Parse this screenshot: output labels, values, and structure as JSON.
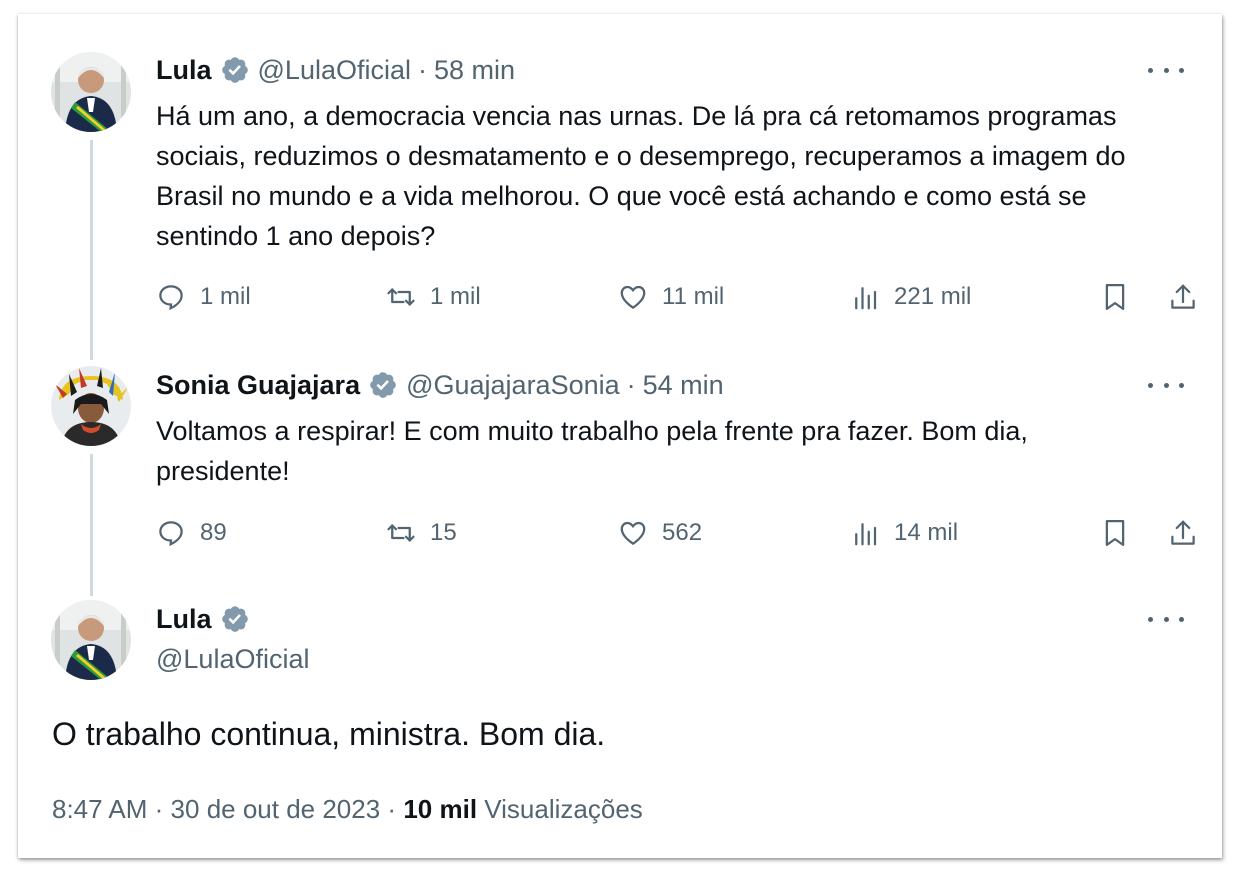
{
  "colors": {
    "verified_badge": "#829aab",
    "secondary_text": "#536471",
    "primary_text": "#0f1419",
    "thread_line": "#cfd9de"
  },
  "icons": {
    "reply": "speech-bubble-icon",
    "retweet": "retweet-arrows-icon",
    "like": "heart-icon",
    "views": "bar-chart-icon",
    "bookmark": "bookmark-icon",
    "share": "share-upload-icon",
    "more": "more-dots-icon",
    "verified": "verified-badge-icon"
  },
  "tweets": [
    {
      "name": "Lula",
      "handle": "@LulaOficial",
      "separator": "·",
      "time": "58 min",
      "text": "Há um ano, a democracia vencia nas urnas. De lá pra cá retomamos programas sociais, reduzimos o desmatamento e o desemprego, recuperamos a imagem do Brasil no mundo e a vida melhorou. O que você está achando e como está se sentindo 1 ano depois?",
      "replies": "1 mil",
      "retweets": "1 mil",
      "likes": "11 mil",
      "views": "221 mil"
    },
    {
      "name": "Sonia Guajajara",
      "handle": "@GuajajaraSonia",
      "separator": "·",
      "time": "54 min",
      "text": "Voltamos a respirar! E com muito trabalho pela frente pra fazer. Bom dia, presidente!",
      "replies": "89",
      "retweets": "15",
      "likes": "562",
      "views": "14 mil"
    }
  ],
  "main_tweet": {
    "name": "Lula",
    "handle": "@LulaOficial",
    "text": "O trabalho continua, ministra. Bom dia.",
    "time": "8:47 AM",
    "separator": "·",
    "date": "30 de out de 2023",
    "views_count": "10 mil",
    "views_label": "Visualizações"
  }
}
